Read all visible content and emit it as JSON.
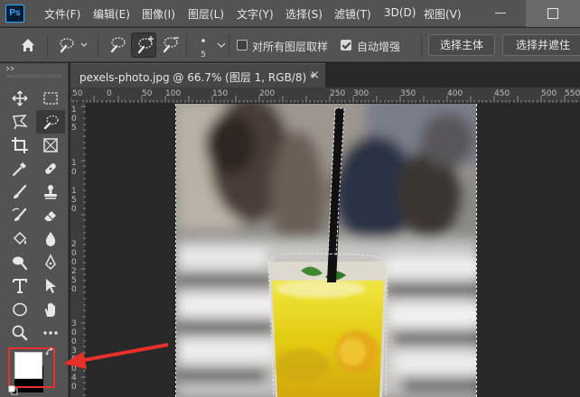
{
  "app": {
    "logo": "Ps"
  },
  "menu": [
    "文件(F)",
    "编辑(E)",
    "图像(I)",
    "图层(L)",
    "文字(Y)",
    "选择(S)",
    "滤镜(T)",
    "3D(D)",
    "视图(V)"
  ],
  "options_bar": {
    "brush_size": "5",
    "sample_all_layers_label": "对所有图层取样",
    "sample_all_layers_checked": false,
    "auto_enhance_label": "自动增强",
    "auto_enhance_checked": true,
    "select_subject_button": "选择主体",
    "select_and_mask_button": "选择并遮住"
  },
  "document_tab": {
    "title": "pexels-photo.jpg @ 66.7% (图层 1, RGB/8) *",
    "close": "×"
  },
  "ruler": {
    "horizontal_labels": [
      "50",
      "0",
      "50",
      "100",
      "150",
      "200",
      "250",
      "300",
      "350",
      "400",
      "450",
      "500",
      "550"
    ],
    "vertical_labels": [
      "1",
      "0",
      "5",
      "1",
      "0",
      "1",
      "5",
      "0",
      "2",
      "0",
      "0",
      "2",
      "5",
      "0",
      "3",
      "0",
      "0",
      "3",
      "5",
      "0",
      "4",
      "0",
      "0",
      "4",
      "5",
      "0"
    ]
  },
  "tools": [
    "move-tool",
    "marquee-tool",
    "lasso-tool",
    "quick-selection-tool",
    "crop-tool",
    "frame-tool",
    "eyedropper-tool",
    "spot-healing-tool",
    "brush-tool",
    "clone-stamp-tool",
    "history-brush-tool",
    "eraser-tool",
    "paint-bucket-tool",
    "blur-tool",
    "dodge-tool",
    "pen-tool",
    "type-tool",
    "path-selection-tool",
    "ellipse-tool",
    "hand-tool",
    "zoom-tool",
    "more-tools"
  ],
  "colors": {
    "foreground": "#ffffff",
    "background": "#000000",
    "highlight": "#e8302a",
    "selection_marquee": "#e8e8e8",
    "drink": "#e8d214"
  }
}
